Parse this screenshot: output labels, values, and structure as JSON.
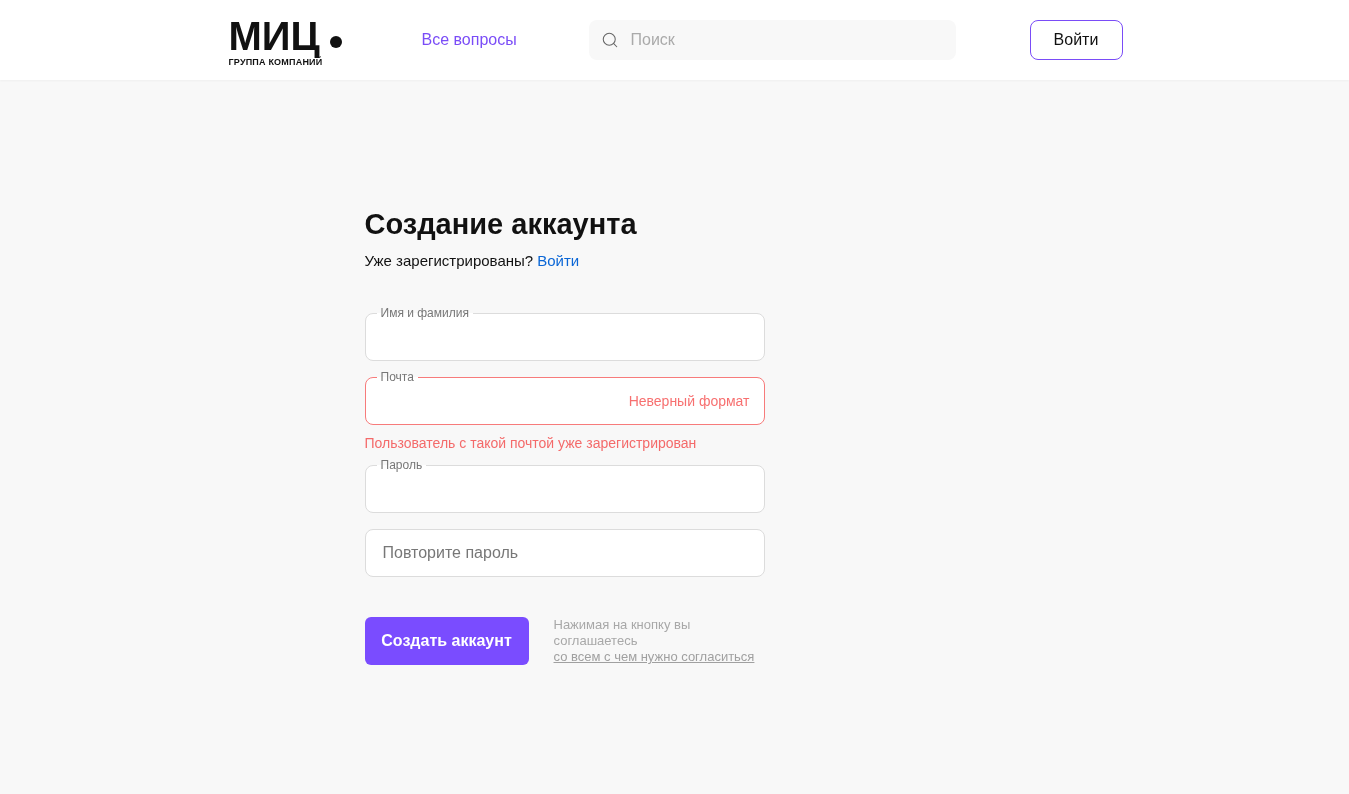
{
  "header": {
    "logo": {
      "name": "МИЦ",
      "tagline": "ГРУППА КОМПАНИЙ"
    },
    "nav_link": "Все вопросы",
    "search": {
      "placeholder": "Поиск"
    },
    "login_button": "Войти"
  },
  "form": {
    "title": "Создание аккаунта",
    "subtitle": "Уже зарегистрированы?",
    "subtitle_link": "Войти",
    "fields": [
      {
        "label": "Имя и фамилия",
        "error": false
      },
      {
        "label": "Почта",
        "error": true,
        "inline_error": "Неверный формат",
        "error_message": "Пользователь с такой почтой уже зарегистрирован"
      },
      {
        "label": "Пароль",
        "error": false
      },
      {
        "placeholder": "Повторите пароль",
        "error": false
      }
    ],
    "submit_button": "Создать аккаунт",
    "terms": {
      "text": "Нажимая на кнопку вы соглашаетесь",
      "link": "со всем с чем нужно согласиться"
    }
  }
}
